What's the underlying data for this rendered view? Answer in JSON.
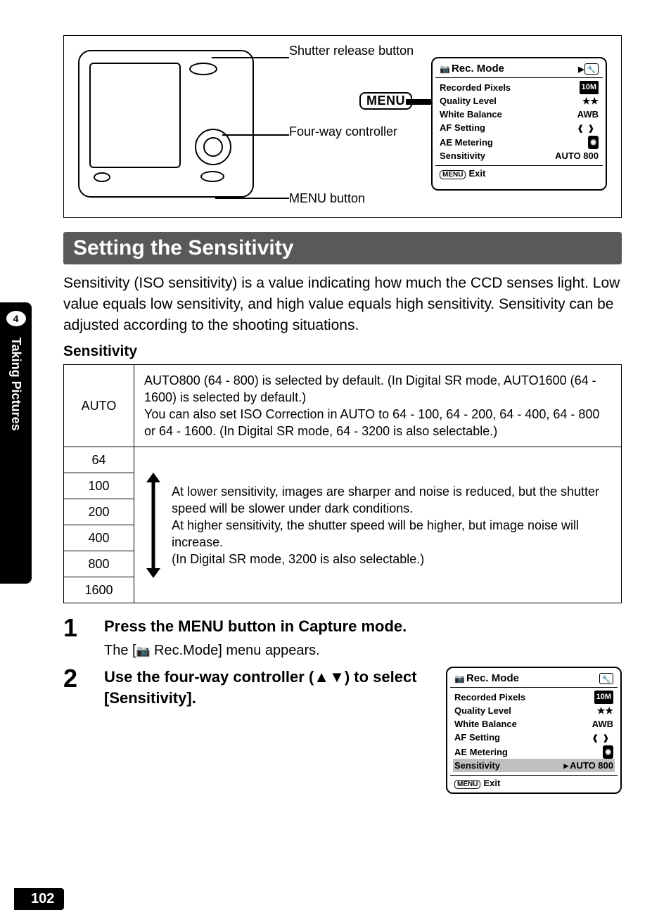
{
  "page_number": "102",
  "side_tab": {
    "chapter_num": "4",
    "chapter_title": "Taking Pictures"
  },
  "diagram": {
    "shutter_label": "Shutter release button",
    "fourway_label": "Four-way controller",
    "menu_btn_label": "MENU button",
    "menu_key": "MENU"
  },
  "lcd": {
    "header": "Rec. Mode",
    "rows": {
      "recorded_pixels": {
        "label": "Recorded Pixels",
        "value": "10M"
      },
      "quality_level": {
        "label": "Quality Level",
        "value": "★★"
      },
      "white_balance": {
        "label": "White Balance",
        "value": "AWB"
      },
      "af_setting": {
        "label": "AF Setting",
        "value": ""
      },
      "ae_metering": {
        "label": "AE Metering",
        "value": ""
      },
      "sensitivity": {
        "label": "Sensitivity",
        "value": "AUTO 800"
      }
    },
    "footer_btn": "MENU",
    "footer_text": "Exit"
  },
  "heading": "Setting the Sensitivity",
  "intro": "Sensitivity (ISO sensitivity) is a value indicating how much the CCD senses light. Low value equals low sensitivity, and high value equals high sensitivity. Sensitivity can be adjusted according to the shooting situations.",
  "subhead": "Sensitivity",
  "table": {
    "auto_label": "AUTO",
    "auto_desc": "AUTO800 (64 - 800) is selected by default. (In Digital SR mode, AUTO1600 (64 - 1600) is selected by default.)\nYou can also set ISO Correction in AUTO to 64 - 100, 64 - 200, 64 - 400, 64 - 800 or 64 - 1600. (In Digital SR mode, 64 - 3200 is also selectable.)",
    "iso_values": [
      "64",
      "100",
      "200",
      "400",
      "800",
      "1600"
    ],
    "range_desc": "At lower sensitivity, images are sharper and noise is reduced, but the shutter speed will be slower under dark conditions.\nAt higher sensitivity, the shutter speed will be higher, but image noise will increase.\n(In Digital SR mode, 3200 is also selectable.)"
  },
  "steps": {
    "s1": {
      "num": "1",
      "title": "Press the MENU button in Capture mode.",
      "sub_pre": "The [",
      "sub_post": " Rec.Mode] menu appears."
    },
    "s2": {
      "num": "2",
      "title_pre": "Use the four-way controller (",
      "title_post": ") to select [Sensitivity]."
    }
  }
}
